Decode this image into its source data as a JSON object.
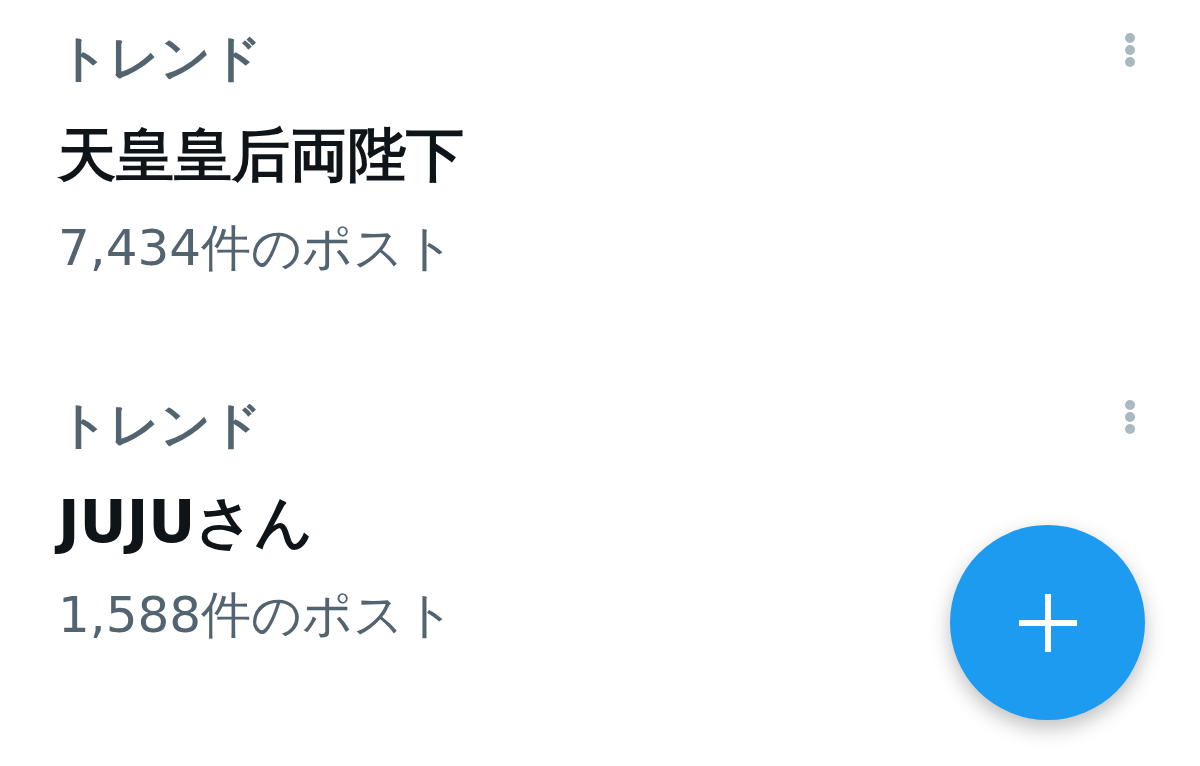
{
  "trends": [
    {
      "label": "トレンド",
      "title": "天皇皇后両陛下",
      "count": "7,434件のポスト"
    },
    {
      "label": "トレンド",
      "title": "JUJUさん",
      "count": "1,588件のポスト"
    }
  ]
}
